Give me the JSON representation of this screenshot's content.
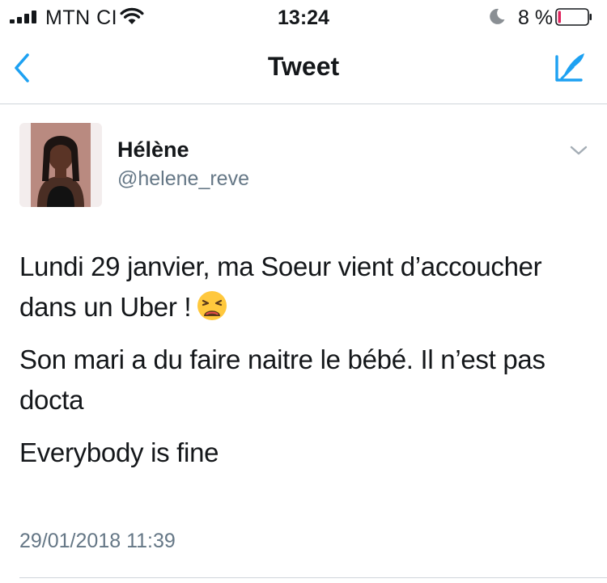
{
  "colors": {
    "accent": "#1da1f2",
    "text": "#14171a",
    "secondary_text": "#657786",
    "battery_low": "#e0245e",
    "divider": "#cfd5da"
  },
  "status_bar": {
    "carrier": "MTN CI",
    "time": "13:24",
    "battery_percent": "8 %",
    "battery_level": 0.08,
    "icons": [
      "signal-icon",
      "wifi-icon",
      "moon-icon",
      "battery-icon"
    ]
  },
  "nav": {
    "title": "Tweet",
    "back_icon": "chevron-left-icon",
    "compose_icon": "compose-icon"
  },
  "tweet": {
    "author": {
      "name": "Hélène",
      "handle": "@helene_reve"
    },
    "paragraphs": [
      "Lundi 29 janvier, ma Soeur vient d’accoucher dans un Uber !",
      "Son mari a du faire naitre le bébé. Il n’est pas docta",
      "Everybody is fine"
    ],
    "emoji": "weary-face",
    "timestamp": "29/01/2018 11:39"
  }
}
